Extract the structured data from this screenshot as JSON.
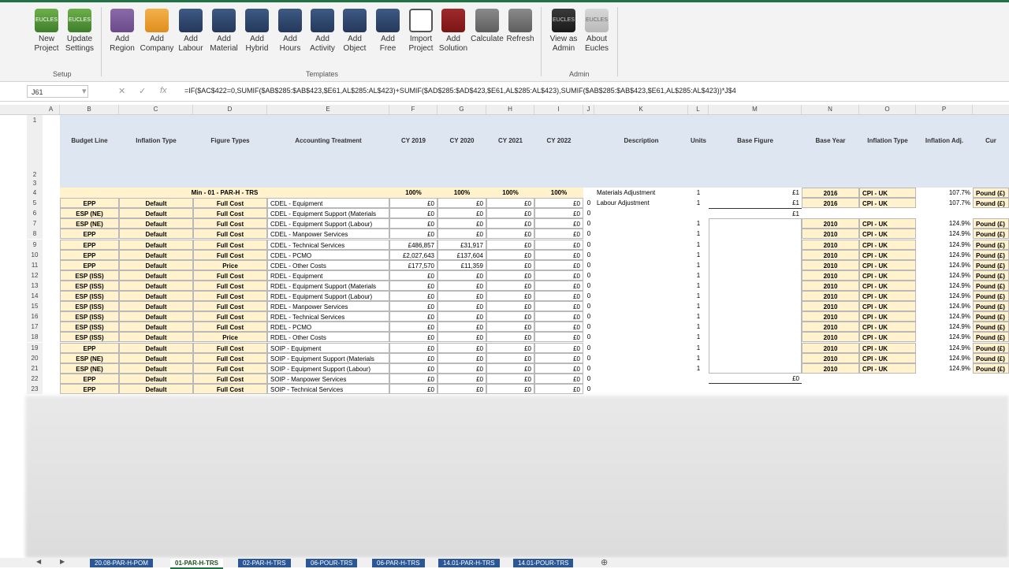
{
  "ribbon": {
    "buttons": [
      {
        "label": "New\nProject",
        "icon": "eucles-green-icon"
      },
      {
        "label": "Update\nSettings",
        "icon": "eucles-green-icon"
      },
      {
        "label": "Add\nRegion",
        "icon": "map-icon"
      },
      {
        "label": "Add\nCompany",
        "icon": "bar-chart-icon"
      },
      {
        "label": "Add\nLabour",
        "icon": "tiles-icon"
      },
      {
        "label": "Add\nMaterial",
        "icon": "tiles-icon"
      },
      {
        "label": "Add\nHybrid",
        "icon": "tiles-icon"
      },
      {
        "label": "Add\nHours",
        "icon": "tiles-icon"
      },
      {
        "label": "Add\nActivity",
        "icon": "tiles-icon"
      },
      {
        "label": "Add\nObject",
        "icon": "tiles-icon"
      },
      {
        "label": "Add\nFree",
        "icon": "tiles-icon"
      },
      {
        "label": "Import\nProject",
        "icon": "import-icon"
      },
      {
        "label": "Add\nSolution",
        "icon": "chart-red-icon"
      },
      {
        "label": "Calculate",
        "icon": "calculator-icon"
      },
      {
        "label": "Refresh",
        "icon": "calculator-icon"
      },
      {
        "label": "View as\nAdmin",
        "icon": "eucles-black-icon"
      },
      {
        "label": "About\nEucles",
        "icon": "eucles-light-icon"
      }
    ],
    "groups": {
      "setup": "Setup",
      "templates": "Templates",
      "admin": "Admin"
    },
    "logo_text": "EUCLES"
  },
  "formula_bar": {
    "name_box": "J61",
    "formula": "=IF($AC$422=0,SUMIF($AB$285:$AB$423,$E61,AL$285:AL$423)+SUMIF($AD$285:$AD$423,$E61,AL$285:AL$423),SUMIF($AB$285:$AB$423,$E61,AL$285:AL$423))*J$4"
  },
  "columns": [
    "A",
    "B",
    "C",
    "D",
    "E",
    "F",
    "G",
    "H",
    "I",
    "J",
    "K",
    "L",
    "M",
    "N",
    "O",
    "P"
  ],
  "headers": {
    "budget_line": "Budget Line",
    "inflation_type": "Inflation Type",
    "figure_types": "Figure Types",
    "accounting_treatment": "Accounting Treatment",
    "cy2019": "CY 2019",
    "cy2020": "CY 2020",
    "cy2021": "CY 2021",
    "cy2022": "CY 2022",
    "description": "Description",
    "units": "Units",
    "base_figure": "Base Figure",
    "base_year": "Base Year",
    "inflation_type2": "Inflation Type",
    "inflation_adj": "Inflation Adj.",
    "cur": "Cur"
  },
  "row4": {
    "title": "Min - 01 - PAR-H - TRS",
    "f": "100%",
    "g": "100%",
    "h": "100%",
    "i": "100%",
    "k": "Materials Adjustment",
    "l": "1",
    "m": "£1",
    "n": "2016",
    "o": "CPI - UK",
    "p": "107.7%",
    "q": "Pound (£)"
  },
  "row5": {
    "k": "Labour Adjustment",
    "l": "1",
    "m": "£1",
    "n": "2016",
    "o": "CPI - UK",
    "p": "107.7%",
    "q": "Pound (£)"
  },
  "row6_m": "£1",
  "row22_m": "£0",
  "rows": [
    {
      "r": "5",
      "b": "EPP",
      "c": "Default",
      "d": "Full Cost",
      "e": "CDEL - Equipment",
      "f": "£0",
      "g": "£0",
      "h": "£0",
      "i": "£0",
      "j": "0"
    },
    {
      "r": "6",
      "b": "ESP (NE)",
      "c": "Default",
      "d": "Full Cost",
      "e": "CDEL - Equipment Support (Materials",
      "f": "£0",
      "g": "£0",
      "h": "£0",
      "i": "£0",
      "j": "0"
    },
    {
      "r": "7",
      "b": "ESP (NE)",
      "c": "Default",
      "d": "Full Cost",
      "e": "CDEL - Equipment Support (Labour)",
      "f": "£0",
      "g": "£0",
      "h": "£0",
      "i": "£0",
      "j": "0",
      "l": "1",
      "n": "2010",
      "o": "CPI - UK",
      "p": "124.9%",
      "q": "Pound (£)"
    },
    {
      "r": "8",
      "b": "EPP",
      "c": "Default",
      "d": "Full Cost",
      "e": "CDEL - Manpower Services",
      "f": "£0",
      "g": "£0",
      "h": "£0",
      "i": "£0",
      "j": "0",
      "l": "1",
      "n": "2010",
      "o": "CPI - UK",
      "p": "124.9%",
      "q": "Pound (£)"
    },
    {
      "r": "9",
      "b": "EPP",
      "c": "Default",
      "d": "Full Cost",
      "e": "CDEL - Technical Services",
      "f": "£486,857",
      "g": "£31,917",
      "h": "£0",
      "i": "£0",
      "j": "0",
      "l": "1",
      "n": "2010",
      "o": "CPI - UK",
      "p": "124.9%",
      "q": "Pound (£)"
    },
    {
      "r": "10",
      "b": "EPP",
      "c": "Default",
      "d": "Full Cost",
      "e": "CDEL - PCMO",
      "f": "£2,027,643",
      "g": "£137,604",
      "h": "£0",
      "i": "£0",
      "j": "0",
      "l": "1",
      "n": "2010",
      "o": "CPI - UK",
      "p": "124.9%",
      "q": "Pound (£)"
    },
    {
      "r": "11",
      "b": "EPP",
      "c": "Default",
      "d": "Price",
      "e": "CDEL - Other Costs",
      "f": "£177,570",
      "g": "£11,359",
      "h": "£0",
      "i": "£0",
      "j": "0",
      "l": "1",
      "n": "2010",
      "o": "CPI - UK",
      "p": "124.9%",
      "q": "Pound (£)"
    },
    {
      "r": "12",
      "b": "ESP (ISS)",
      "c": "Default",
      "d": "Full Cost",
      "e": "RDEL - Equipment",
      "f": "£0",
      "g": "£0",
      "h": "£0",
      "i": "£0",
      "j": "0",
      "l": "1",
      "n": "2010",
      "o": "CPI - UK",
      "p": "124.9%",
      "q": "Pound (£)"
    },
    {
      "r": "13",
      "b": "ESP (ISS)",
      "c": "Default",
      "d": "Full Cost",
      "e": "RDEL - Equipment Support (Materials",
      "f": "£0",
      "g": "£0",
      "h": "£0",
      "i": "£0",
      "j": "0",
      "l": "1",
      "n": "2010",
      "o": "CPI - UK",
      "p": "124.9%",
      "q": "Pound (£)"
    },
    {
      "r": "14",
      "b": "ESP (ISS)",
      "c": "Default",
      "d": "Full Cost",
      "e": "RDEL - Equipment Support (Labour)",
      "f": "£0",
      "g": "£0",
      "h": "£0",
      "i": "£0",
      "j": "0",
      "l": "1",
      "n": "2010",
      "o": "CPI - UK",
      "p": "124.9%",
      "q": "Pound (£)"
    },
    {
      "r": "15",
      "b": "ESP (ISS)",
      "c": "Default",
      "d": "Full Cost",
      "e": "RDEL - Manpower Services",
      "f": "£0",
      "g": "£0",
      "h": "£0",
      "i": "£0",
      "j": "0",
      "l": "1",
      "n": "2010",
      "o": "CPI - UK",
      "p": "124.9%",
      "q": "Pound (£)"
    },
    {
      "r": "16",
      "b": "ESP (ISS)",
      "c": "Default",
      "d": "Full Cost",
      "e": "RDEL - Technical Services",
      "f": "£0",
      "g": "£0",
      "h": "£0",
      "i": "£0",
      "j": "0",
      "l": "1",
      "n": "2010",
      "o": "CPI - UK",
      "p": "124.9%",
      "q": "Pound (£)"
    },
    {
      "r": "17",
      "b": "ESP (ISS)",
      "c": "Default",
      "d": "Full Cost",
      "e": "RDEL - PCMO",
      "f": "£0",
      "g": "£0",
      "h": "£0",
      "i": "£0",
      "j": "0",
      "l": "1",
      "n": "2010",
      "o": "CPI - UK",
      "p": "124.9%",
      "q": "Pound (£)"
    },
    {
      "r": "18",
      "b": "ESP (ISS)",
      "c": "Default",
      "d": "Price",
      "e": "RDEL - Other Costs",
      "f": "£0",
      "g": "£0",
      "h": "£0",
      "i": "£0",
      "j": "0",
      "l": "1",
      "n": "2010",
      "o": "CPI - UK",
      "p": "124.9%",
      "q": "Pound (£)"
    },
    {
      "r": "19",
      "b": "EPP",
      "c": "Default",
      "d": "Full Cost",
      "e": "SOIP - Equipment",
      "f": "£0",
      "g": "£0",
      "h": "£0",
      "i": "£0",
      "j": "0",
      "l": "1",
      "n": "2010",
      "o": "CPI - UK",
      "p": "124.9%",
      "q": "Pound (£)"
    },
    {
      "r": "20",
      "b": "ESP (NE)",
      "c": "Default",
      "d": "Full Cost",
      "e": "SOIP - Equipment Support (Materials",
      "f": "£0",
      "g": "£0",
      "h": "£0",
      "i": "£0",
      "j": "0",
      "l": "1",
      "n": "2010",
      "o": "CPI - UK",
      "p": "124.9%",
      "q": "Pound (£)"
    },
    {
      "r": "21",
      "b": "ESP (NE)",
      "c": "Default",
      "d": "Full Cost",
      "e": "SOIP - Equipment Support (Labour)",
      "f": "£0",
      "g": "£0",
      "h": "£0",
      "i": "£0",
      "j": "0",
      "l": "1",
      "n": "2010",
      "o": "CPI - UK",
      "p": "124.9%",
      "q": "Pound (£)"
    },
    {
      "r": "22",
      "b": "EPP",
      "c": "Default",
      "d": "Full Cost",
      "e": "SOIP - Manpower Services",
      "f": "£0",
      "g": "£0",
      "h": "£0",
      "i": "£0",
      "j": "0"
    },
    {
      "r": "23",
      "b": "EPP",
      "c": "Default",
      "d": "Full Cost",
      "e": "SOIP - Technical Services",
      "f": "£0",
      "g": "£0",
      "h": "£0",
      "i": "£0",
      "j": "0"
    }
  ],
  "tabs": [
    "20.08-PAR-H-POM",
    "01-PAR-H-TRS",
    "02-PAR-H-TRS",
    "06-POUR-TRS",
    "06-PAR-H-TRS",
    "14.01-PAR-H-TRS",
    "14.01-POUR-TRS"
  ],
  "active_tab": "01-PAR-H-TRS"
}
